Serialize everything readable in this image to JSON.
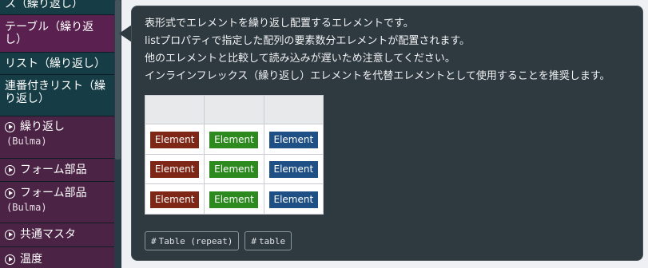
{
  "sidebar": {
    "items": [
      {
        "label": "ス（繰り返し）"
      },
      {
        "label": "テーブル（繰り返し）"
      },
      {
        "label": "リスト（繰り返し）"
      },
      {
        "label": "連番付きリスト（繰り返し）"
      },
      {
        "label": "繰り返し",
        "sub": "(Bulma)"
      },
      {
        "label": "フォーム部品"
      },
      {
        "label": "フォーム部品",
        "sub": "(Bulma)"
      },
      {
        "label": "共通マスタ"
      },
      {
        "label": "温度"
      }
    ]
  },
  "tooltip": {
    "lines": [
      "表形式でエレメントを繰り返し配置するエレメントです。",
      "listプロパティで指定した配列の要素数分エレメントが配置されます。",
      "他のエレメントと比較して読み込みが遅いため注意してください。",
      "インラインフレックス（繰り返し）エレメントを代替エレメントとして使用することを推奨します。"
    ],
    "example": {
      "element_label": "Element",
      "colors": {
        "red": "#7e2717",
        "green": "#2d8a1f",
        "blue": "#1e5086"
      }
    },
    "tags": [
      {
        "hash": "#",
        "label": "Table (repeat)"
      },
      {
        "hash": "#",
        "label": "table"
      }
    ]
  }
}
